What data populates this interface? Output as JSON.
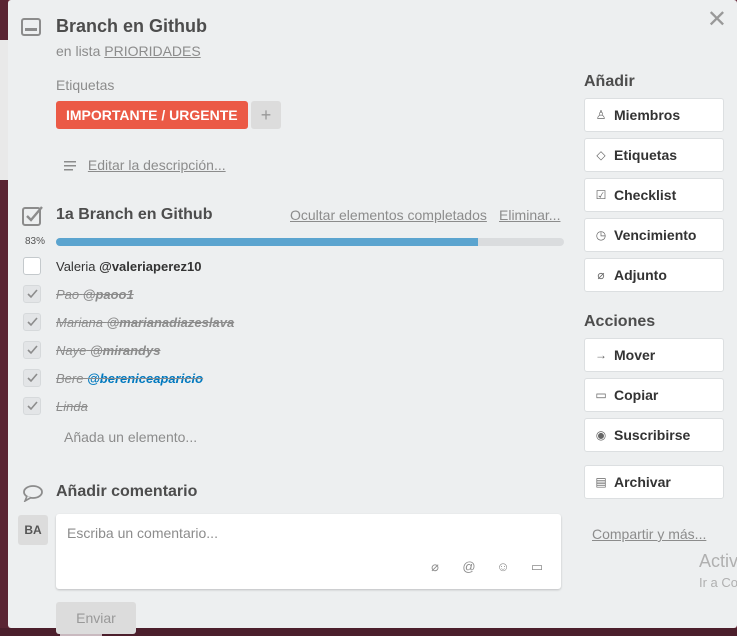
{
  "card": {
    "title": "Branch en Github",
    "in_list_prefix": "en lista",
    "list_name": "PRIORIDADES",
    "labels_title": "Etiquetas",
    "label": "IMPORTANTE / URGENTE",
    "label_color": "#eb5a46",
    "label_add": "+",
    "edit_description": "Editar la descripción..."
  },
  "checklist": {
    "title": "1a Branch en Github",
    "hide_completed": "Ocultar elementos completados",
    "delete": "Eliminar...",
    "progress_label": "83%",
    "progress_fraction": 0.83,
    "items": [
      {
        "name": "Valeria",
        "mention": "@valeriaperez10",
        "done": false
      },
      {
        "name": "Pao",
        "mention": "@paoo1",
        "done": true
      },
      {
        "name": "Mariana",
        "mention": "@marianadiazeslava",
        "done": true
      },
      {
        "name": "Naye",
        "mention": "@mirandys",
        "done": true
      },
      {
        "name": "Bere",
        "mention": "@bereniceaparicio",
        "done": true
      },
      {
        "name": "Linda",
        "mention": "",
        "done": true
      }
    ],
    "add_item": "Añada un elemento..."
  },
  "comment": {
    "title": "Añadir comentario",
    "avatar": "BA",
    "placeholder": "Escriba un comentario...",
    "send": "Enviar"
  },
  "sidebar": {
    "add_title": "Añadir",
    "add_buttons": [
      "Miembros",
      "Etiquetas",
      "Checklist",
      "Vencimiento",
      "Adjunto"
    ],
    "actions_title": "Acciones",
    "action_buttons": [
      "Mover",
      "Copiar",
      "Suscribirse",
      "Archivar"
    ],
    "share": "Compartir y más..."
  },
  "watermark": {
    "line1": "Activ",
    "line2": "Ir a Co"
  },
  "colors": {
    "progress_fill": "#5ba4cf",
    "mention_link": "#0079bf"
  }
}
